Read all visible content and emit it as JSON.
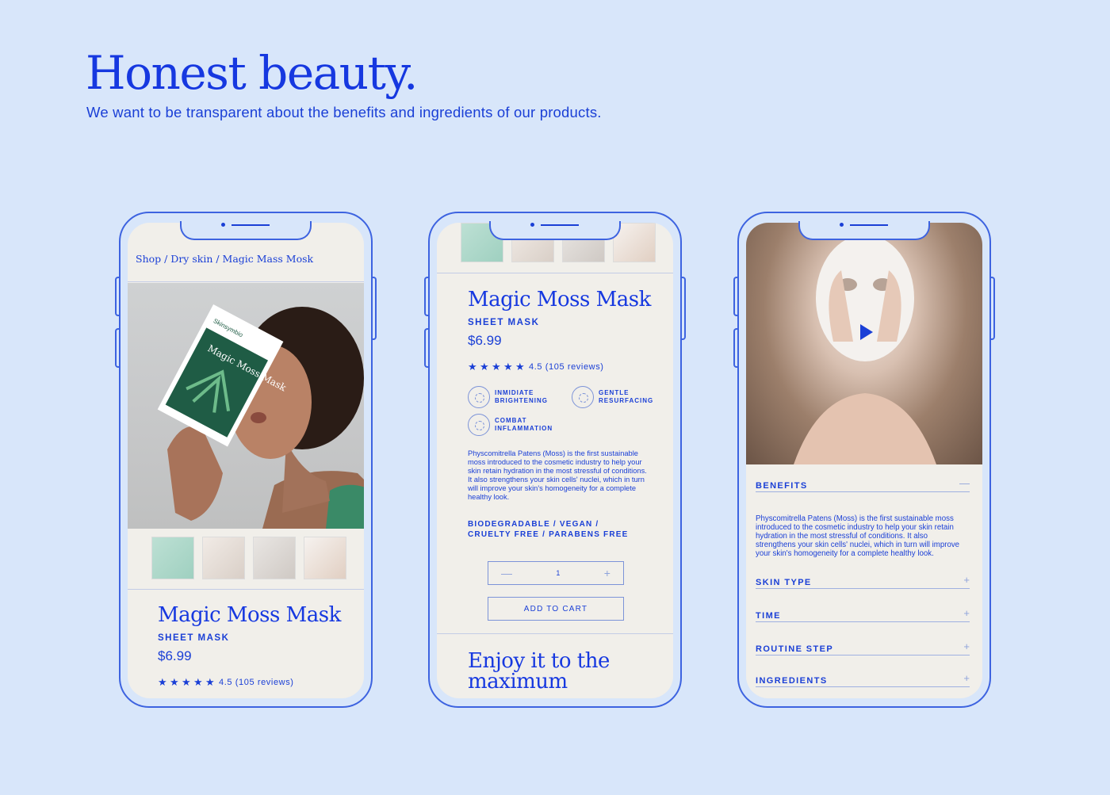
{
  "hero": {
    "title": "Honest beauty.",
    "subtitle": "We want to be transparent about the benefits and ingredients of our products."
  },
  "phone1": {
    "breadcrumb": "Shop / Dry skin / Magic Mass Mosk",
    "packet_brand": "Skinsymbio",
    "packet_name": "Magic Moss Mask",
    "product_title": "Magic Moss Mask",
    "product_type": "SHEET MASK",
    "price": "$6.99",
    "rating_value": 4.5,
    "rating_text": "4.5 (105 reviews)"
  },
  "phone2": {
    "product_title": "Magic Moss Mask",
    "product_type": "SHEET MASK",
    "price": "$6.99",
    "rating_value": 4.5,
    "rating_text": "4.5 (105 reviews)",
    "badges": [
      {
        "line1": "INMIDIATE",
        "line2": "BRIGHTENING"
      },
      {
        "line1": "GENTLE",
        "line2": "RESURFACING"
      },
      {
        "line1": "COMBAT",
        "line2": "INFLAMMATION"
      }
    ],
    "description": "Physcomitrella Patens (Moss) is the first sustainable moss introduced to the cosmetic industry to help your skin retain hydration in the most stressful of conditions. It also strengthens your skin cells' nuclei, which in turn will improve your skin's homogeneity for a complete healthy look.",
    "attributes_line1": "BIODEGRADABLE / VEGAN /",
    "attributes_line2": "CRUELTY FREE / PARABENS FREE",
    "quantity": "1",
    "minus": "—",
    "plus": "+",
    "add_to_cart": "ADD TO CART",
    "enjoy_line1": "Enjoy it to the",
    "enjoy_line2": "maximum"
  },
  "phone3": {
    "accordion": [
      {
        "label": "BENEFITS",
        "toggle": "—",
        "expanded": true
      },
      {
        "label": "SKIN TYPE",
        "toggle": "+",
        "expanded": false
      },
      {
        "label": "TIME",
        "toggle": "+",
        "expanded": false
      },
      {
        "label": "ROUTINE STEP",
        "toggle": "+",
        "expanded": false
      },
      {
        "label": "INGREDIENTS",
        "toggle": "+",
        "expanded": false
      }
    ],
    "benefits_text": "Physcomitrella Patens (Moss) is the first sustainable moss introduced to the cosmetic industry to help your skin retain hydration in the most stressful of conditions. It also strengthens your skin cells' nuclei, which in turn will improve your skin's homogeneity for a complete healthy look."
  },
  "icons": {
    "star": "star-icon",
    "play": "play-icon",
    "badge": "badge-icon"
  },
  "colors": {
    "background": "#d8e6fa",
    "accent": "#1a3fd6",
    "screen": "#f1efea"
  }
}
